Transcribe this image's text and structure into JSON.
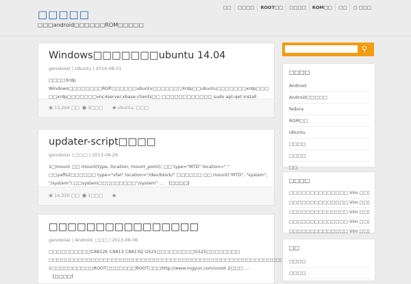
{
  "site": {
    "title": "□□□□□",
    "description": "□□□android□□□□□□ROM□□□□□"
  },
  "topnav": [
    {
      "label": "□□",
      "strong": false
    },
    {
      "label": "□□□□",
      "strong": false
    },
    {
      "label": "ROOT□□",
      "strong": true
    },
    {
      "label": "□□□□",
      "strong": false
    },
    {
      "label": "ROM□□",
      "strong": true
    },
    {
      "label": "□□",
      "strong": false
    },
    {
      "label": "□ □□□",
      "strong": false
    }
  ],
  "posts": [
    {
      "title": "Windows□□□□□□□ubuntu 14.04",
      "meta": "genokolar | Ubuntu | 2014-08-01",
      "excerpt": "□□□□Xrdp Windows□□□□□□□□RDP□□□□□□ubuntu□□□□□□□Xrdp□□ubuntu□□□□□□□xrdp□□□ □□xrdp□□□□□□□vnc4server.xbase-clients□□ □□□□□□□□□□□□ sudo apt-get install xrdp vnc4server xbase-clients □□□□□□ □□□□□/usr/share/applications□□□□ \"□□□\" □□□□□□□□…",
      "more": "[□□□□]",
      "views": "13,264 □□",
      "comments": "3□□□",
      "tags": "ubuntu, □□□"
    },
    {
      "title": "updater-script□□□□",
      "meta": "genokolar | □□□ | 2013-09-29",
      "excerpt": "1□mount □□ mount(type, location, mount_point); □□ type=\"MTD\" location=\" \" □□yaffs2□□□□□□ type=\"vfat\" location=\"/dev/block/\" □□□□□□ □□ mount(\"MTD\", \"system\", \"/system\");□□system□□□□□□□□□\"/system\" …",
      "more": "[□□□□]",
      "views": "14,350 □□",
      "comments": "1□□□",
      "tags": ""
    },
    {
      "title": "□□□□□□□□□□□□□□□□",
      "meta": "genokolar | Android, □□□ | 2013-08-06",
      "excerpt": "□□□□□□□□□□C8812E C8813 C8813Q G525□□□□□□□□□G525□□□□□□□□ □□□□□□□□□□□□□□□□□□□□□□□□□□□□□□□□□□□□□□□□□□□□□□□□□□□□□□□□□□□ 1□□□□□□□□□□ROOT□□□□□□□ROOT□□□http://www.mgyun.com/vroot 2□□□ …",
      "more": "[□□□□]",
      "views": "",
      "comments": "",
      "tags": ""
    }
  ],
  "search": {
    "placeholder": "",
    "icon": "search-icon"
  },
  "widgets": [
    {
      "title": "□□□□",
      "items": [
        "Android",
        "Android□□□□□",
        "fedora",
        "ROM□□",
        "Ubuntu",
        "□□□□",
        "□□□□",
        "□□"
      ]
    },
    {
      "title": "□□□□",
      "items": [
        "□□□□□□□□□□□□□□ Vim □□□□□",
        "□□□□□□□□□□□□□□ Vim □□□□□",
        "□□□□□□□□□□□□□□ Vim □□□□□",
        "□□□□□□□□□□□□□□ Vim □□□□□",
        "□□□□□□□□□□□□□□ Vim □□□□□"
      ]
    },
    {
      "title": "□□",
      "items": [
        "□□□□",
        "□□□□"
      ]
    }
  ]
}
